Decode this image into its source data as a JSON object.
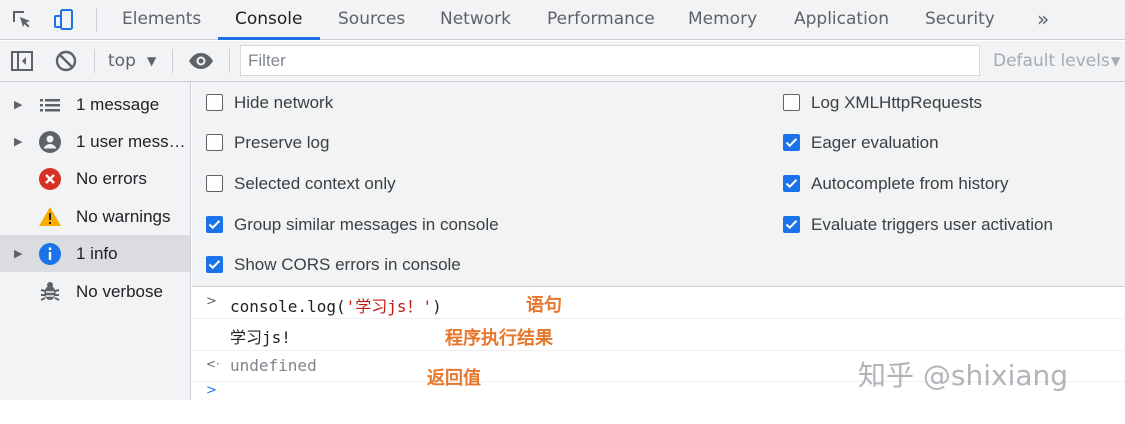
{
  "tabs": {
    "items": [
      "Elements",
      "Console",
      "Sources",
      "Network",
      "Performance",
      "Memory",
      "Application",
      "Security"
    ],
    "more": "»",
    "active": "Console"
  },
  "toolbar": {
    "context": "top",
    "filter_placeholder": "Filter",
    "levels": "Default levels"
  },
  "sidebar": {
    "items": [
      {
        "label": "1 message",
        "icon": "list-icon",
        "expandable": true
      },
      {
        "label": "1 user mess…",
        "icon": "user-icon",
        "expandable": true
      },
      {
        "label": "No errors",
        "icon": "error-icon",
        "expandable": false
      },
      {
        "label": "No warnings",
        "icon": "warning-icon",
        "expandable": false
      },
      {
        "label": "1 info",
        "icon": "info-icon",
        "expandable": true,
        "selected": true
      },
      {
        "label": "No verbose",
        "icon": "bug-icon",
        "expandable": false
      }
    ]
  },
  "settings": {
    "left": [
      {
        "label": "Hide network",
        "checked": false
      },
      {
        "label": "Preserve log",
        "checked": false
      },
      {
        "label": "Selected context only",
        "checked": false
      },
      {
        "label": "Group similar messages in console",
        "checked": true
      },
      {
        "label": "Show CORS errors in console",
        "checked": true
      }
    ],
    "right": [
      {
        "label": "Log XMLHttpRequests",
        "checked": false
      },
      {
        "label": "Eager evaluation",
        "checked": true
      },
      {
        "label": "Autocomplete from history",
        "checked": true
      },
      {
        "label": "Evaluate triggers user activation",
        "checked": true
      }
    ]
  },
  "console": {
    "input_prefix": "console.log(",
    "input_string": "'学习js！'",
    "input_suffix": ")",
    "output": "学习js!",
    "return_value": "undefined",
    "prompt_symbol": ">",
    "return_symbol": "<·"
  },
  "annotations": {
    "statement": "语句",
    "result": "程序执行结果",
    "return_value": "返回值"
  },
  "watermark": "知乎 @shixiang",
  "colors": {
    "accent": "#1a73e8",
    "annotation": "#e8772e",
    "string": "#c41a16"
  }
}
